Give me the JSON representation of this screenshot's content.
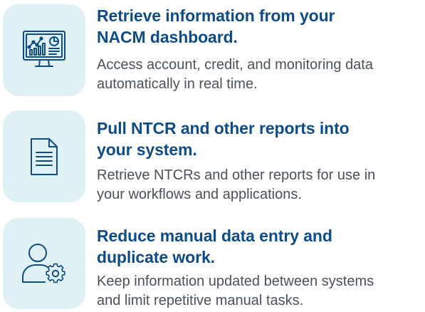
{
  "colors": {
    "tile_background": "#e0f1f6",
    "title": "#0d4c87",
    "description": "#4a5258",
    "icon_stroke": "#0d4c87"
  },
  "features": [
    {
      "icon": "dashboard-monitor-icon",
      "title_line_1": "Retrieve information from your",
      "title_line_2": "NACM dashboard.",
      "desc_line_1": "Access account, credit, and monitoring data",
      "desc_line_2": "automatically in real time."
    },
    {
      "icon": "document-icon",
      "title_line_1": "Pull NTCR and other reports into",
      "title_line_2": "your system.",
      "desc_line_1": "Retrieve NTCRs and other reports for use in",
      "desc_line_2": "your workflows and applications."
    },
    {
      "icon": "user-settings-icon",
      "title_line_1": "Reduce manual data entry and",
      "title_line_2": "duplicate work.",
      "desc_line_1": "Keep information updated between systems",
      "desc_line_2": "and limit repetitive manual tasks."
    }
  ]
}
